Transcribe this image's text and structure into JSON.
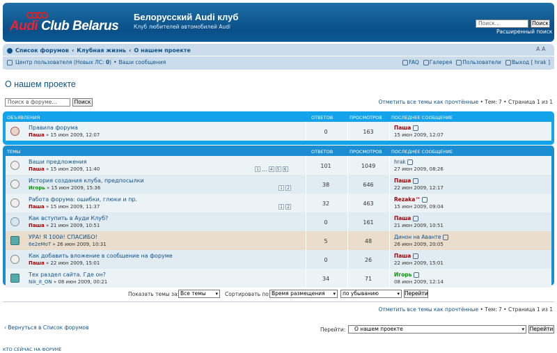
{
  "header": {
    "logo_prefix": "Audi",
    "logo_suffix": " Club Belarus",
    "site_title": "Белорусский Audi клуб",
    "site_desc": "Клуб любителей автомобилей Audi",
    "search_placeholder": "Поиск...",
    "search_button": "Поиск",
    "advanced_search": "Расширенный поиск"
  },
  "breadcrumb": [
    "Список форумов",
    "‹",
    "Клубная жизнь",
    "‹",
    "О нашем проекте"
  ],
  "font_size_control": "A A",
  "navbar": {
    "ucp": "Центр пользователя (Новых ЛС: ",
    "ucp_count": "0",
    "ucp_close": ")",
    "bullet": "•",
    "my_posts": "Ваши сообщения",
    "faq": "FAQ",
    "gallery": "Галерея",
    "members": "Пользователи",
    "logout": "Выход [ hrak ]"
  },
  "page_title": "О нашем проекте",
  "forum_search": {
    "placeholder": "Поиск в форуме...",
    "button": "Поиск"
  },
  "page_info": {
    "mark_read": "Отметить все темы как прочтённые",
    "topics": " • Тем: 7 • Страница ",
    "page_of": "1 из 1"
  },
  "announcements": {
    "heading": "Объявления",
    "col_replies": "Ответов",
    "col_views": "Просмотров",
    "col_last": "Последнее сообщение",
    "rows": [
      {
        "title": "Правила форума",
        "author": "Паша",
        "date": " » 15 июн 2009, 12:07",
        "replies": "0",
        "views": "163",
        "last_author": "Паша",
        "last_date": "15 июн 2009, 12:07"
      }
    ]
  },
  "topics": {
    "heading": "Темы",
    "col_replies": "Ответов",
    "col_views": "Просмотров",
    "col_last": "Последнее сообщение",
    "rows": [
      {
        "title": "Ваши предложения",
        "author": "Паша",
        "date": " » 15 июн 2009, 11:40",
        "replies": "101",
        "views": "1049",
        "last_author": "hrak",
        "last_date": "27 июн 2009, 08:26",
        "pages": [
          "1",
          "...",
          "4",
          "5",
          "6"
        ]
      },
      {
        "title": "История создания клуба, предпосылки",
        "author": "Игорь",
        "date": " » 15 июн 2009, 15:36",
        "replies": "38",
        "views": "646",
        "last_author": "Паша",
        "last_date": "22 июн 2009, 12:17",
        "pages": [
          "1",
          "2"
        ]
      },
      {
        "title": "Работа форума: ошибки, глюки и пр.",
        "author": "Паша",
        "date": " » 15 июн 2009, 11:37",
        "replies": "32",
        "views": "463",
        "last_author": "Rezaka™",
        "last_date": "15 июн 2009, 09:04",
        "pages": [
          "1",
          "2"
        ]
      },
      {
        "title": "Как вступить в Ауди Клуб?",
        "author": "Паша",
        "date": " » 21 июн 2009, 10:51",
        "replies": "0",
        "views": "161",
        "last_author": "Паша",
        "last_date": "21 июн 2009, 10:51",
        "pages": []
      },
      {
        "title": "УРА! Я 100й! СПАСИБО!",
        "author": "6e2eMoT",
        "date": " » 26 июн 2009, 10:31",
        "replies": "5",
        "views": "48",
        "last_author": "Динон на Аванте",
        "last_date": "26 июн 2009, 20:05",
        "pages": []
      },
      {
        "title": "Как добавить вложение в сообщение на форуме",
        "author": "Паша",
        "date": " » 22 июн 2009, 15:01",
        "replies": "0",
        "views": "26",
        "last_author": "Паша",
        "last_date": "22 июн 2009, 15:01",
        "pages": []
      },
      {
        "title": "Тех раздел сайта. Где он?",
        "author": "Nik_it_ON",
        "date": " » 08 июн 2009, 00:21",
        "replies": "34",
        "views": "71",
        "last_author": "Игорь",
        "last_date": "08 июн 2009, 12:14",
        "pages": []
      }
    ]
  },
  "sort": {
    "show_label": "Показать темы за:",
    "show_value": "Все темы",
    "sort_label": "Сортировать по:",
    "sort_value": "Время размещения",
    "order_value": "по убыванию",
    "go": "Перейти"
  },
  "footer": {
    "back": "Вернуться в Список форумов",
    "jump_label": "Перейти:",
    "jump_value": "О нашем проекте",
    "jump_go": "Перейти",
    "online": "КТО СЕЙЧАС НА ФОРУМЕ"
  }
}
